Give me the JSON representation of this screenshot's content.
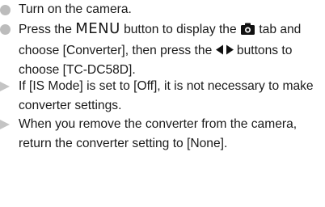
{
  "steps": [
    {
      "bullet": "circle",
      "text": "Turn on the camera."
    },
    {
      "bullet": "circle",
      "part1": "Press the ",
      "menu_label": "MENU",
      "part2": " button to display the ",
      "icon_tab": "camera-icon",
      "part3": " tab and choose [Converter], then press the ",
      "icon_buttons": "left-right-arrows-icon",
      "part4": " buttons to choose [TC-DC58D]."
    }
  ],
  "notes": [
    {
      "bullet": "triangle",
      "text": "If [IS Mode] is set to [Off], it is not necessary to make converter settings."
    },
    {
      "bullet": "triangle",
      "text": "When you remove the converter from the camera, return the converter setting to [None]."
    }
  ],
  "colors": {
    "text": "#1a1a1a",
    "bullet": "#bcbcbc",
    "note_marker": "#c4c4c4"
  }
}
